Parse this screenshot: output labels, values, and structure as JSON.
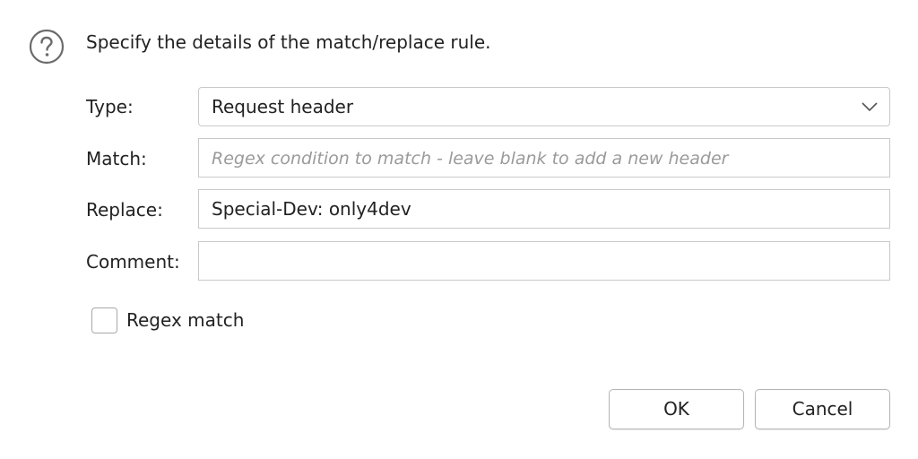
{
  "dialog": {
    "icon": "question-circle-icon",
    "prompt": "Specify the details of the match/replace rule.",
    "fields": {
      "type": {
        "label": "Type:",
        "value": "Request header"
      },
      "match": {
        "label": "Match:",
        "value": "",
        "placeholder": "Regex condition to match - leave blank to add a new header"
      },
      "replace": {
        "label": "Replace:",
        "value": "Special-Dev: only4dev"
      },
      "comment": {
        "label": "Comment:",
        "value": ""
      }
    },
    "regex_match": {
      "label": "Regex match",
      "checked": false
    },
    "buttons": {
      "ok": "OK",
      "cancel": "Cancel"
    }
  },
  "colors": {
    "border": "#c9c9c9",
    "text": "#222222",
    "placeholder": "#9a9a9a",
    "icon": "#6b6b6b"
  }
}
